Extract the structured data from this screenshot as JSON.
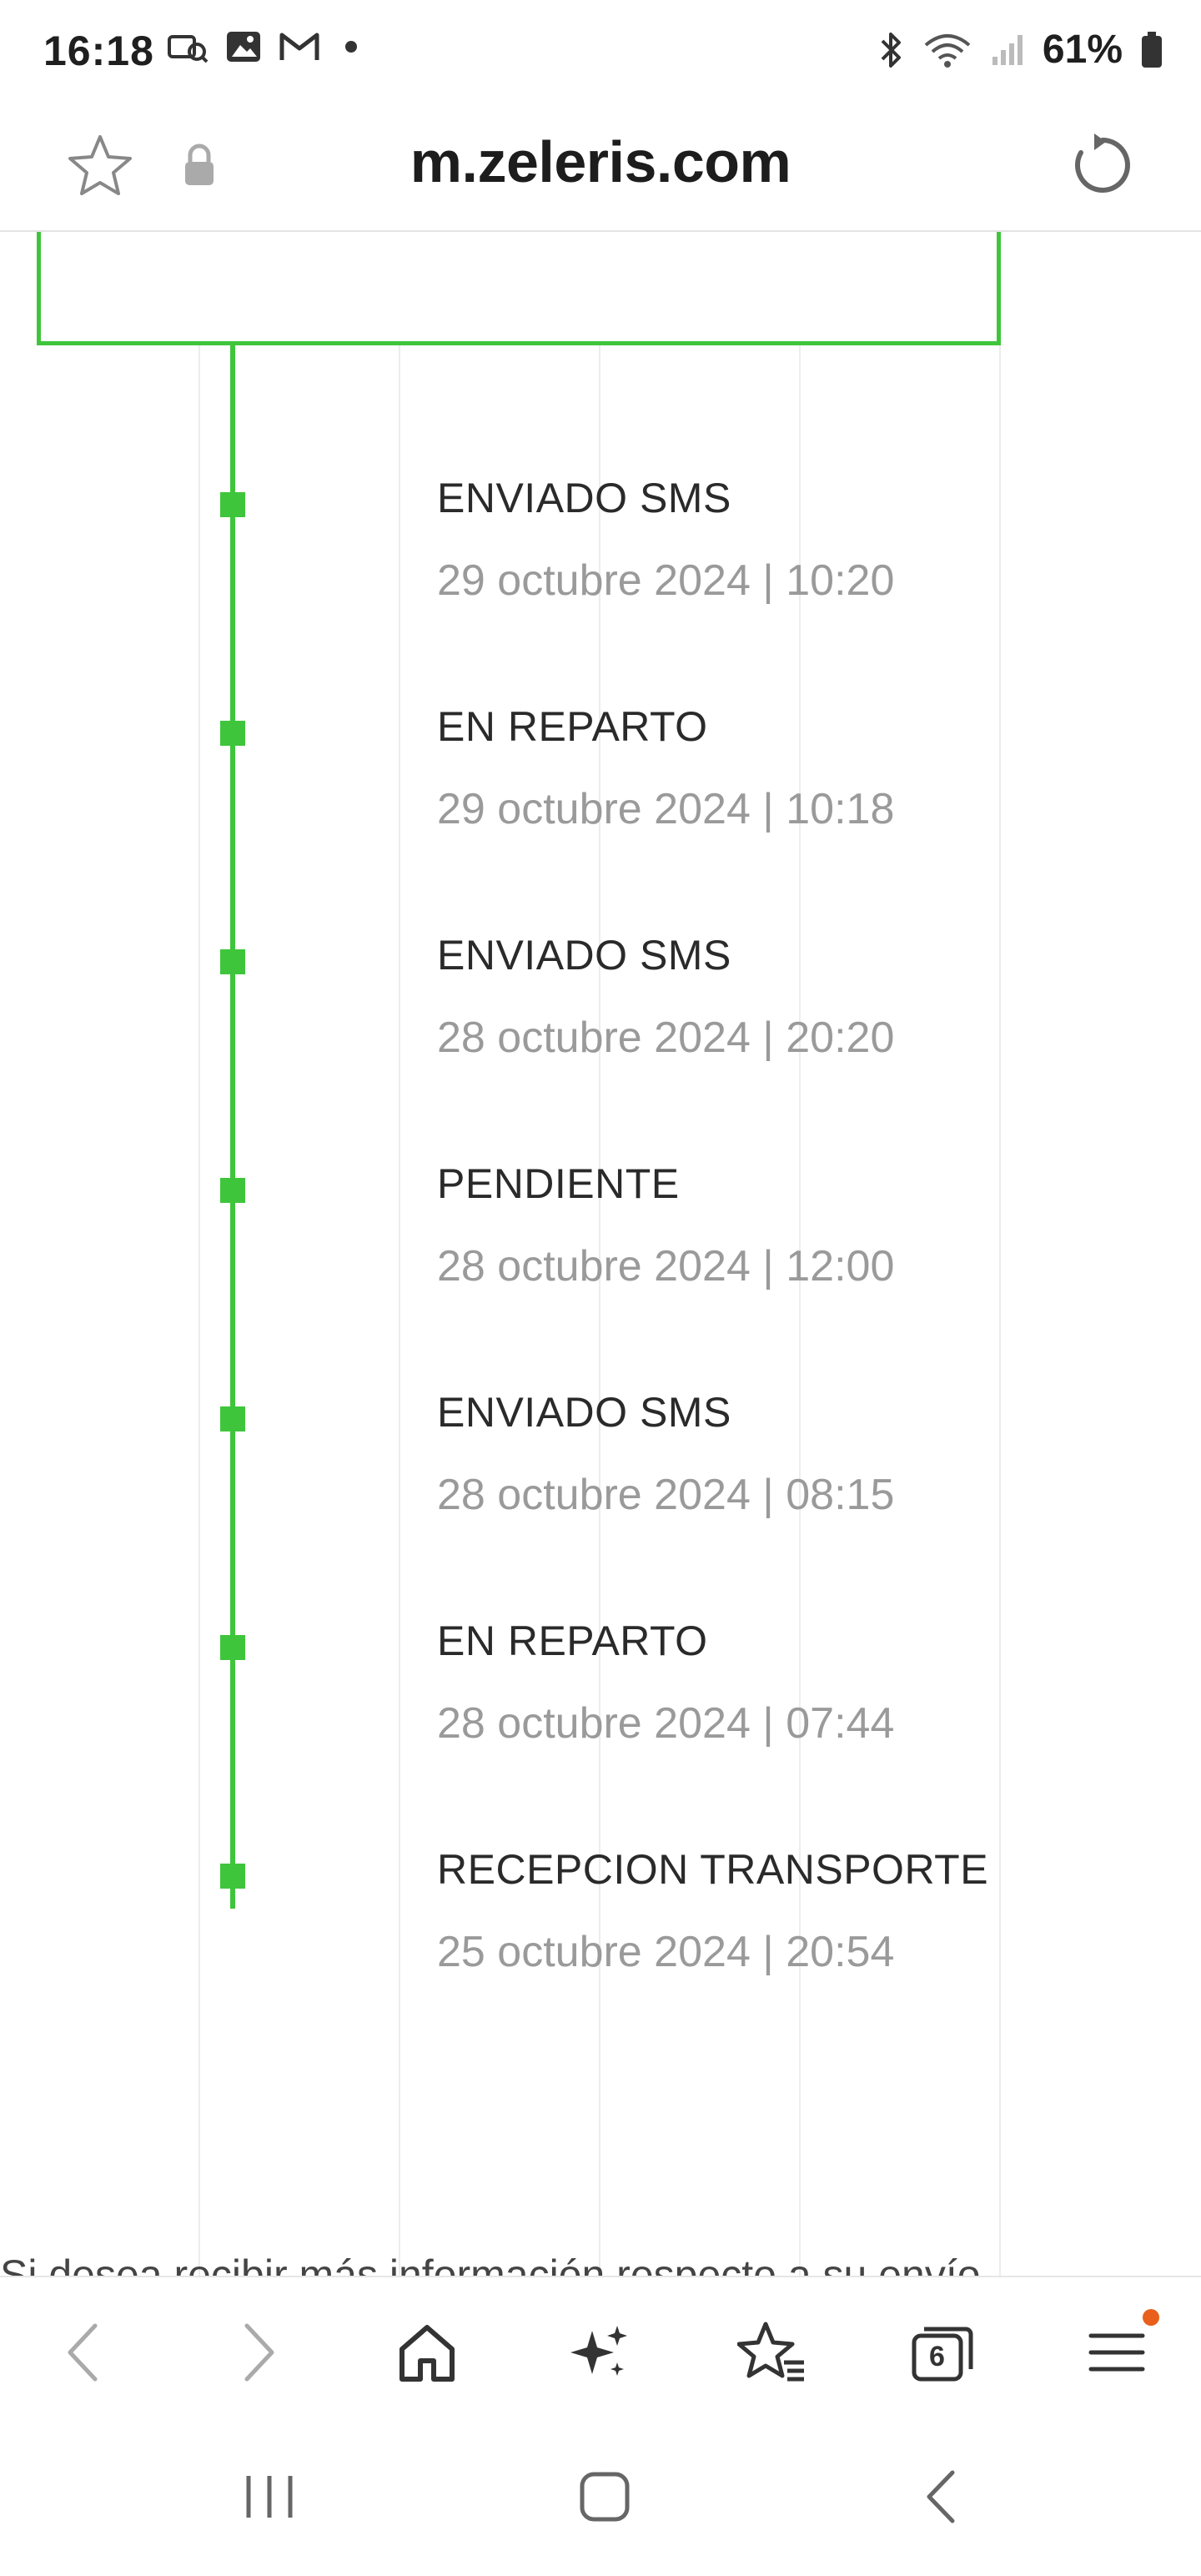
{
  "status_bar": {
    "time": "16:18",
    "battery": "61%",
    "left_icons": [
      "lens-icon",
      "image-icon",
      "gmail-icon",
      "dot-icon"
    ],
    "right_icons": [
      "bluetooth-icon",
      "wifi-icon",
      "signal-icon",
      "battery-icon"
    ]
  },
  "browser": {
    "url": "m.zeleris.com",
    "tab_count": "6"
  },
  "tracking": {
    "events": [
      {
        "status": "ENVIADO SMS",
        "date": "29 octubre 2024 | 10:20"
      },
      {
        "status": "EN REPARTO",
        "date": "29 octubre 2024 | 10:18"
      },
      {
        "status": "ENVIADO SMS",
        "date": "28 octubre 2024 | 20:20"
      },
      {
        "status": "PENDIENTE",
        "date": "28 octubre 2024 | 12:00"
      },
      {
        "status": "ENVIADO SMS",
        "date": "28 octubre 2024 | 08:15"
      },
      {
        "status": "EN REPARTO",
        "date": "28 octubre 2024 | 07:44"
      },
      {
        "status": "RECEPCION TRANSPORTE",
        "date": "25 octubre 2024 | 20:54"
      }
    ],
    "footer": "Si desea recibir más información respecto a su envío"
  },
  "colors": {
    "accent_green": "#3fc53c",
    "date_gray": "#9a9a9a",
    "notification_orange": "#e8601c"
  }
}
